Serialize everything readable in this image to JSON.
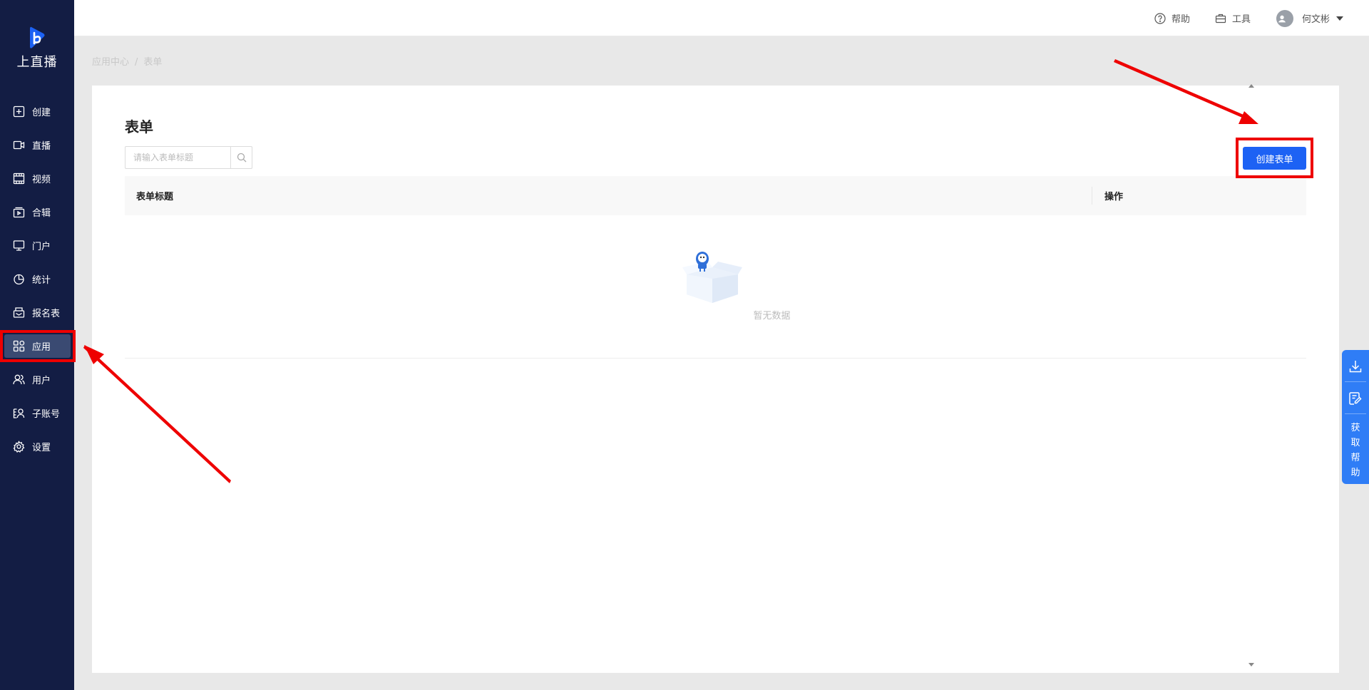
{
  "brand": {
    "name": "上直播",
    "color": "#1d62f4"
  },
  "sidebar": {
    "items": [
      {
        "label": "创建",
        "icon": "plus-square-icon"
      },
      {
        "label": "直播",
        "icon": "video-camera-icon"
      },
      {
        "label": "视频",
        "icon": "film-icon"
      },
      {
        "label": "合辑",
        "icon": "collection-icon"
      },
      {
        "label": "门户",
        "icon": "monitor-icon"
      },
      {
        "label": "统计",
        "icon": "pie-chart-icon"
      },
      {
        "label": "报名表",
        "icon": "form-icon"
      },
      {
        "label": "应用",
        "icon": "apps-grid-icon",
        "active": true
      },
      {
        "label": "用户",
        "icon": "users-icon"
      },
      {
        "label": "子账号",
        "icon": "sub-account-icon"
      },
      {
        "label": "设置",
        "icon": "gear-icon"
      }
    ]
  },
  "header": {
    "help": "帮助",
    "tools": "工具",
    "user_name": "何文彬"
  },
  "breadcrumb": {
    "parent": "应用中心",
    "separator": "/",
    "current": "表单"
  },
  "page": {
    "title": "表单",
    "search_placeholder": "请输入表单标题",
    "create_button": "创建表单",
    "table": {
      "columns": [
        "表单标题",
        "操作"
      ],
      "empty_text": "暂无数据"
    }
  },
  "float_panel": {
    "help_text": [
      "获",
      "取",
      "帮",
      "助"
    ]
  },
  "colors": {
    "sidebar_bg": "#131d44",
    "primary": "#1d62f4",
    "float_bg": "#2f7df6",
    "highlight": "#ee0000"
  }
}
